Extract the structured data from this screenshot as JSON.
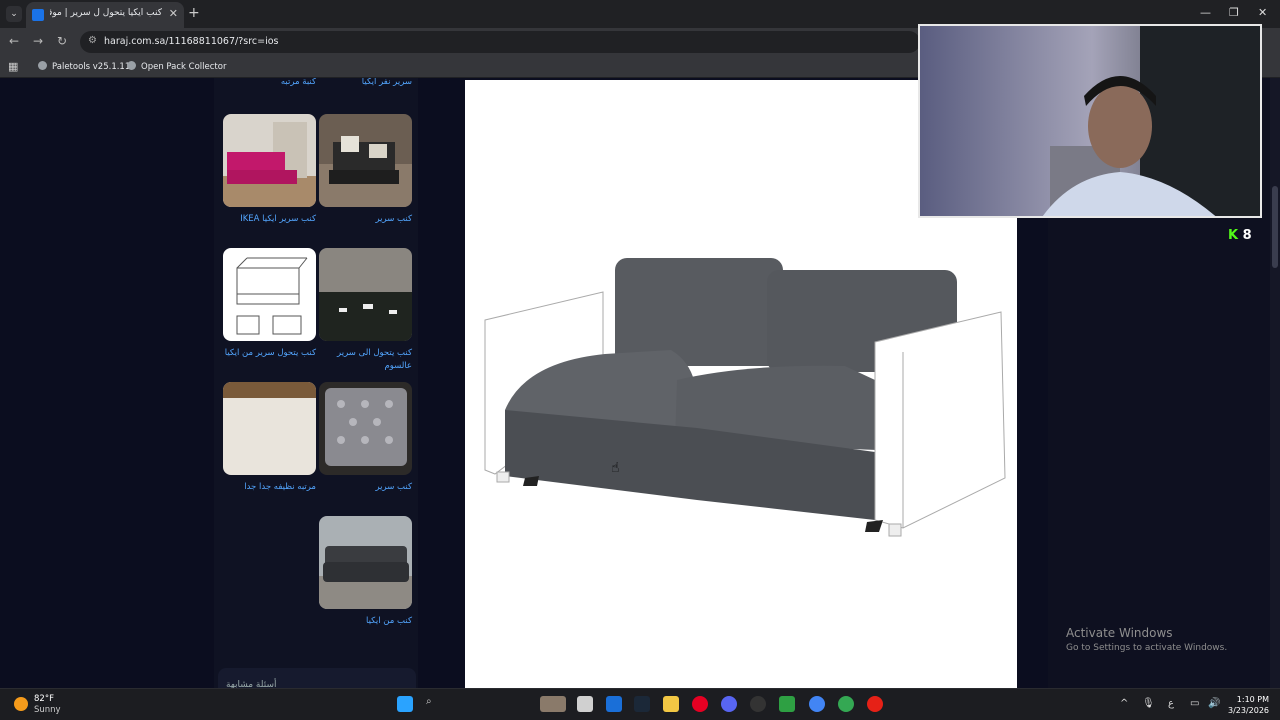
{
  "browser": {
    "tab_title": "كنب ايكيا يتحول ل سرير | موقع ح...",
    "url": "haraj.com.sa/11168811067/?src=ios",
    "bookmarks": [
      {
        "label": "Paletools v25.1.11"
      },
      {
        "label": "Open Pack Collector"
      }
    ]
  },
  "sidebar": {
    "items": [
      {
        "label": "سرير نفر ايكيا"
      },
      {
        "label": "كنبة مرتبه"
      },
      {
        "label": "كنب سرير"
      },
      {
        "label": "كنب سرير ايكيا IKEA"
      },
      {
        "label": "كنب يتحول الى سرير عالسوم"
      },
      {
        "label": "كنب يتحول سرير من ايكيا"
      },
      {
        "label": "كنب سرير"
      },
      {
        "label": "مرتبه نظيفه جدا جدا"
      },
      {
        "label": "كنب من ايكيا"
      }
    ],
    "more_label": "أسئلة مشابهة"
  },
  "stream": {
    "viewer_count": "8"
  },
  "watermark": {
    "title": "Activate Windows",
    "subtitle": "Go to Settings to activate Windows."
  },
  "taskbar": {
    "temperature": "82°F",
    "condition": "Sunny",
    "time": "1:10 PM",
    "date": "3/23/2026",
    "language": "ع"
  },
  "colors": {
    "page_bg": "#0b0d1f",
    "link": "#53a6ff",
    "kick_green": "#53fc18"
  }
}
